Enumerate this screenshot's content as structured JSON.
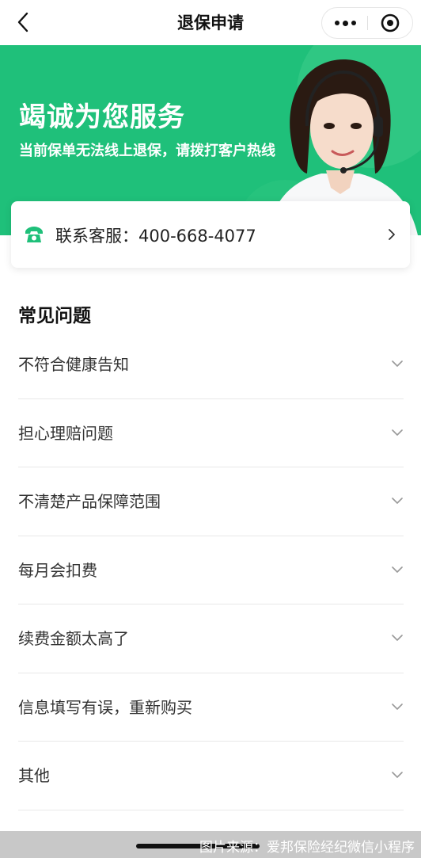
{
  "nav": {
    "title": "退保申请",
    "back_icon": "chevron-left-icon",
    "more_icon": "more-dots-icon",
    "close_icon": "target-circle-icon"
  },
  "banner": {
    "headline": "竭诚为您服务",
    "subline": "当前保单无法线上退保，请拨打客户热线",
    "background_color": "#1fc07a"
  },
  "contact": {
    "label": "联系客服：400-668-4077",
    "icon": "phone-icon",
    "arrow_icon": "chevron-right-icon"
  },
  "faq": {
    "title": "常见问题",
    "items": [
      {
        "label": "不符合健康告知"
      },
      {
        "label": "担心理赔问题"
      },
      {
        "label": "不清楚产品保障范围"
      },
      {
        "label": "每月会扣费"
      },
      {
        "label": "续费金额太高了"
      },
      {
        "label": "信息填写有误，重新购买"
      },
      {
        "label": "其他"
      }
    ]
  },
  "footer": {
    "watermark": "图片来源：爱邦保险经纪微信小程序"
  }
}
